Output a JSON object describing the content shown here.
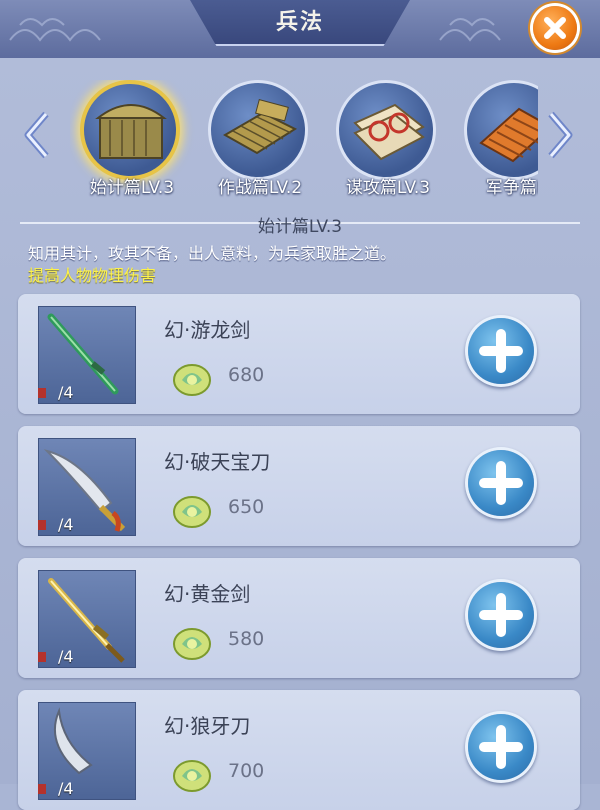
{
  "header": {
    "title": "兵法"
  },
  "categories": [
    {
      "label": "始计篇LV.3",
      "icon": "bamboo-chest-icon",
      "selected": true
    },
    {
      "label": "作战篇LV.2",
      "icon": "bamboo-scroll-icon",
      "selected": false
    },
    {
      "label": "谋攻篇LV.3",
      "icon": "red-seal-book-icon",
      "selected": false
    },
    {
      "label": "军争篇L",
      "icon": "orange-scroll-icon",
      "selected": false
    }
  ],
  "section": {
    "title": "始计篇LV.3",
    "description": "知用其计，攻其不备，出人意料，为兵家取胜之道。",
    "effect": "提高人物物理伤害"
  },
  "items": [
    {
      "name": "幻·游龙剑",
      "count": "/4",
      "cost": "680",
      "icon": "jade-sword-icon"
    },
    {
      "name": "幻·破天宝刀",
      "count": "/4",
      "cost": "650",
      "icon": "broad-saber-icon"
    },
    {
      "name": "幻·黄金剑",
      "count": "/4",
      "cost": "580",
      "icon": "golden-sword-icon"
    },
    {
      "name": "幻·狼牙刀",
      "count": "/4",
      "cost": "700",
      "icon": "curved-blade-icon"
    }
  ],
  "colors": {
    "accent_gold": "#e7c447",
    "effect_text": "#fdf24c",
    "close_orange": "#ee7a14",
    "plus_blue": "#3a89c7"
  }
}
